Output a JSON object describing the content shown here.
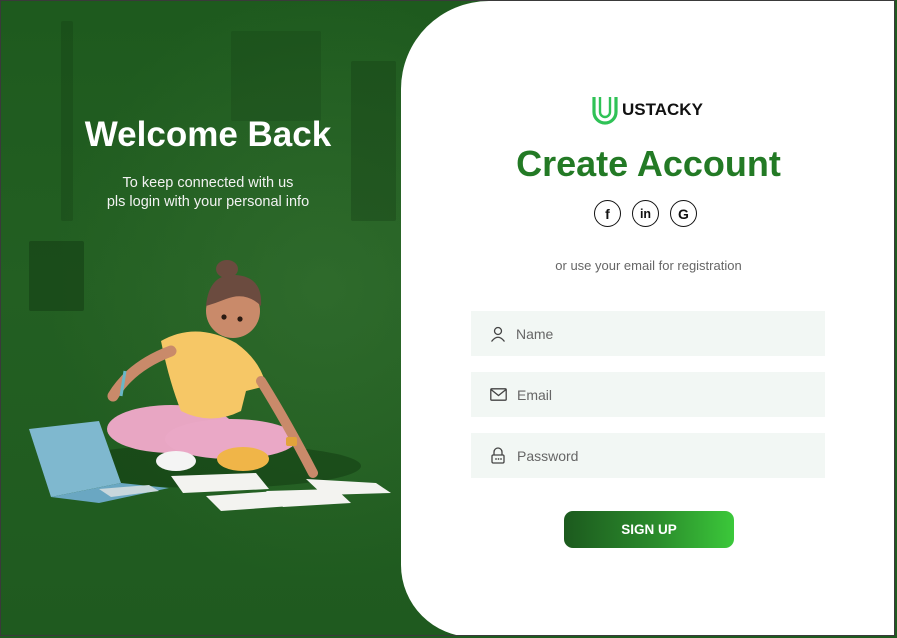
{
  "colors": {
    "brand_green": "#237a25",
    "left_bg": "#215b20",
    "input_bg": "#f2f7f4"
  },
  "welcome": {
    "title": "Welcome Back",
    "subtitle_line1": "To keep connected with us",
    "subtitle_line2": "pls login with your personal info"
  },
  "brand": {
    "name": "USTACKY",
    "icon": "u-logo-icon"
  },
  "form": {
    "title": "Create Account",
    "socials": [
      {
        "icon": "facebook-icon",
        "label": "f"
      },
      {
        "icon": "linkedin-icon",
        "label": "in"
      },
      {
        "icon": "google-icon",
        "label": "G"
      }
    ],
    "alt_text": "or use your email for registration",
    "fields": {
      "name": {
        "placeholder": "Name",
        "icon": "user-icon"
      },
      "email": {
        "placeholder": "Email",
        "icon": "mail-icon"
      },
      "password": {
        "placeholder": "Password",
        "icon": "lock-icon"
      }
    },
    "submit_label": "SIGN UP"
  }
}
